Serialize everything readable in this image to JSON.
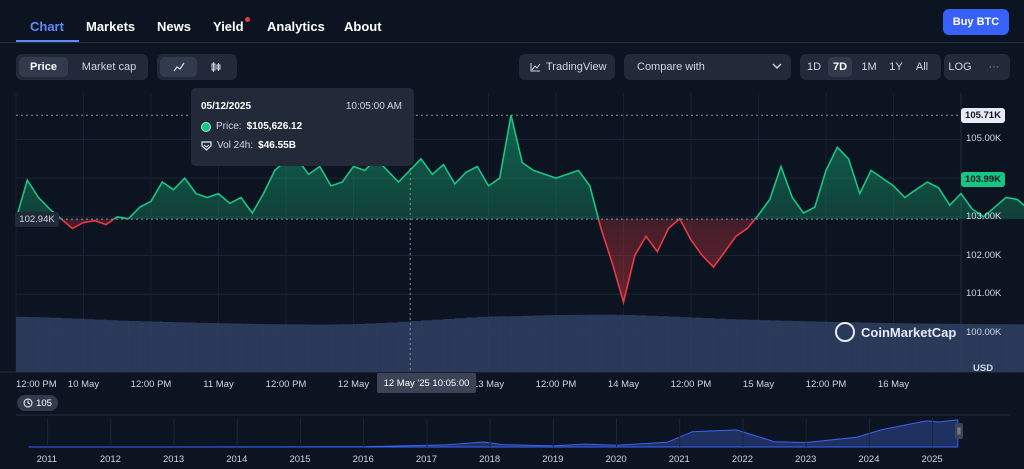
{
  "nav": {
    "items": [
      "Chart",
      "Markets",
      "News",
      "Yield",
      "Analytics",
      "About"
    ],
    "active": "Chart",
    "buy_label": "Buy BTC"
  },
  "toolbar": {
    "mode_options": [
      "Price",
      "Market cap"
    ],
    "active_mode": "Price",
    "chart_style_icons": [
      "line-chart-icon",
      "candlestick-icon"
    ],
    "tradingview_label": "TradingView",
    "compare_label": "Compare with",
    "ranges": [
      "1D",
      "7D",
      "1M",
      "1Y",
      "All"
    ],
    "active_range": "7D",
    "log_label": "LOG",
    "more_label": "···"
  },
  "tooltip": {
    "date": "05/12/2025",
    "time": "10:05:00 AM",
    "price_label": "Price:",
    "price_value": "$105,626.12",
    "vol_label": "Vol 24h:",
    "vol_value": "$46.55B"
  },
  "watermark": "CoinMarketCap",
  "volume_badge": "105",
  "hover_x_label": "12 May '25 10:05:00",
  "colors": {
    "up": "#16c784",
    "down": "#ea3943",
    "accent": "#3861fb",
    "volume": "#2f3f63",
    "background": "#0d1421"
  },
  "chart_data": {
    "type": "area",
    "title": "",
    "currency": "USD",
    "baseline_price": 102940,
    "baseline_label": "102.94K",
    "current_price_label": "103.99K",
    "high_label": "105.71K",
    "y_ticks": [
      {
        "value": 105000,
        "label": "105.00K"
      },
      {
        "value": 104000,
        "label": "104.00K"
      },
      {
        "value": 103000,
        "label": "103.00K"
      },
      {
        "value": 102000,
        "label": "102.00K"
      },
      {
        "value": 101000,
        "label": "101.00K"
      },
      {
        "value": 100000,
        "label": "100.00K"
      }
    ],
    "y_unit_label": "USD",
    "ylim": [
      99300,
      106200
    ],
    "x_ticks": [
      "12:00 PM",
      "10 May",
      "12:00 PM",
      "11 May",
      "12:00 PM",
      "12 May",
      "13 May",
      "12:00 PM",
      "14 May",
      "12:00 PM",
      "15 May",
      "12:00 PM",
      "16 May"
    ],
    "x_tick_hours": [
      12,
      24,
      36,
      48,
      60,
      72,
      96,
      108,
      120,
      132,
      144,
      156,
      168
    ],
    "x_start_label": "09 May 2025 12:00 PM",
    "x_range_hours": [
      12,
      180
    ],
    "x_step_hours": 2,
    "hover_hour": 82.08,
    "prices": [
      102940,
      103950,
      103500,
      103200,
      102950,
      102700,
      102850,
      102900,
      102800,
      103000,
      102950,
      103250,
      103400,
      103900,
      103700,
      104000,
      103600,
      103500,
      103600,
      103350,
      103500,
      103100,
      103600,
      104200,
      104450,
      104500,
      104100,
      104300,
      103800,
      103900,
      104300,
      104200,
      104500,
      104200,
      103900,
      104200,
      104500,
      104100,
      104350,
      103850,
      104150,
      104300,
      103800,
      104000,
      105626,
      104400,
      104200,
      104100,
      104000,
      104100,
      104200,
      103800,
      102700,
      101800,
      100800,
      102000,
      102500,
      102100,
      102700,
      102950,
      102400,
      102000,
      101700,
      102100,
      102500,
      102700,
      103050,
      103450,
      104300,
      103500,
      103100,
      103250,
      104200,
      104800,
      104500,
      103600,
      104200,
      104000,
      103800,
      103500,
      103700,
      103900,
      103750,
      103300,
      103600,
      103200,
      103000,
      103250,
      103500,
      103450,
      103200,
      102950,
      103200,
      103500,
      103450,
      103250,
      103850,
      102900,
      102300,
      102200,
      101800,
      101500,
      102100,
      102300,
      101700,
      102500,
      103150,
      103500,
      103900,
      103300,
      103500,
      103600,
      103650,
      103400,
      103800,
      104050,
      103990
    ],
    "volumes_usd_billions": [
      46.0,
      45.8,
      45.5,
      45.2,
      44.8,
      44.5,
      44.0,
      43.6,
      43.2,
      42.8,
      42.5,
      42.2,
      42.0,
      41.7,
      41.5,
      41.2,
      41.0,
      40.8,
      40.6,
      40.4,
      40.2,
      40.0,
      39.9,
      39.8,
      39.7,
      39.6,
      39.5,
      39.5,
      39.6,
      39.8,
      40.0,
      40.4,
      40.8,
      41.3,
      41.8,
      42.4,
      43.0,
      43.6,
      44.2,
      44.8,
      45.4,
      46.0,
      46.2,
      46.4,
      46.55,
      46.8,
      47.1,
      47.3,
      47.5,
      47.6,
      47.7,
      47.8,
      47.8,
      47.7,
      47.5,
      47.2,
      46.9,
      46.5,
      46.1,
      45.7,
      45.3,
      44.9,
      44.5,
      44.1,
      43.8,
      43.5,
      43.2,
      42.9,
      42.7,
      42.4,
      42.2,
      42.0,
      41.8,
      41.6,
      41.4,
      41.2,
      41.0,
      40.8,
      40.6,
      40.5,
      40.4,
      40.3,
      40.2,
      40.1,
      40.0,
      39.9,
      39.9,
      39.8,
      39.8,
      39.7,
      39.7,
      39.6,
      39.6,
      39.6,
      39.5,
      39.5,
      39.5,
      39.5,
      39.6,
      39.7,
      39.8,
      39.9,
      40.0,
      40.2,
      40.4,
      40.6,
      40.8,
      41.0,
      41.2,
      41.4,
      41.6,
      41.8,
      42.0,
      42.1,
      42.2,
      42.3,
      42.4
    ],
    "volume_ylim": [
      0,
      60
    ],
    "overview": {
      "type": "area",
      "years": [
        2011,
        2012,
        2013,
        2014,
        2015,
        2016,
        2017,
        2018,
        2019,
        2020,
        2021,
        2022,
        2023,
        2024,
        2025
      ],
      "x": [
        2010.7,
        2013,
        2016,
        2017.3,
        2017.9,
        2018.2,
        2019.0,
        2019.5,
        2020.0,
        2020.8,
        2021.2,
        2021.9,
        2022.5,
        2023.0,
        2023.8,
        2024.2,
        2024.9,
        2025.1,
        2025.4
      ],
      "y": [
        0,
        0,
        1,
        8,
        19,
        9,
        4,
        11,
        7,
        18,
        58,
        65,
        20,
        17,
        37,
        66,
        99,
        95,
        103
      ],
      "ylim": [
        0,
        110
      ]
    }
  }
}
